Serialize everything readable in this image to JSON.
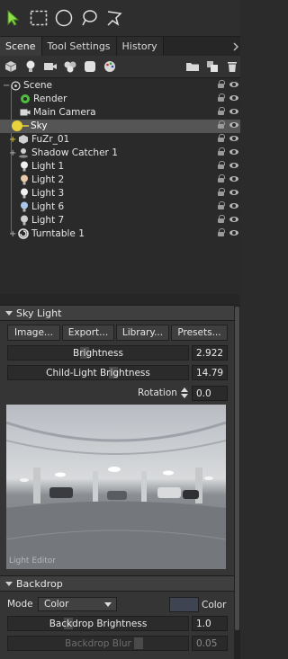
{
  "toolbar": {
    "tools": [
      "select-arrow-icon",
      "rect-select-icon",
      "circle-select-icon",
      "lasso-select-icon",
      "paint-select-icon"
    ]
  },
  "tabs": [
    {
      "label": "Scene",
      "active": true
    },
    {
      "label": "Tool Settings",
      "active": false
    },
    {
      "label": "History",
      "active": false
    }
  ],
  "scene_tree": {
    "root": "Scene",
    "items": [
      {
        "label": "Render",
        "icon": "render-icon"
      },
      {
        "label": "Main Camera",
        "icon": "camera-icon"
      },
      {
        "label": "Sky",
        "icon": "sky-icon",
        "selected": true
      },
      {
        "label": "FuZr_01",
        "icon": "model-icon",
        "expandable": true
      },
      {
        "label": "Shadow Catcher 1",
        "icon": "shadow-catcher-icon",
        "expandable": true
      },
      {
        "label": "Light 1",
        "icon": "light-bulb-icon"
      },
      {
        "label": "Light 2",
        "icon": "light-bulb-icon"
      },
      {
        "label": "Light 3",
        "icon": "light-bulb-icon"
      },
      {
        "label": "Light 6",
        "icon": "light-bulb-icon"
      },
      {
        "label": "Light 7",
        "icon": "light-bulb-icon"
      },
      {
        "label": "Turntable 1",
        "icon": "turntable-icon",
        "expandable": true
      }
    ]
  },
  "sky_light": {
    "title": "Sky Light",
    "buttons": [
      "Image...",
      "Export...",
      "Library...",
      "Presets..."
    ],
    "brightness_label": "Brightness",
    "brightness_value": "2.922",
    "child_brightness_label": "Child-Light Brightness",
    "child_brightness_value": "14.79",
    "rotation_label": "Rotation",
    "rotation_value": "0.0",
    "editor_watermark": "Light Editor"
  },
  "backdrop": {
    "title": "Backdrop",
    "mode_label": "Mode",
    "mode_value": "Color",
    "color_label": "Color",
    "brightness_label": "Backdrop Brightness",
    "brightness_value": "1.0",
    "blur_label": "Backdrop Blur",
    "blur_value": "0.05"
  },
  "colors": {
    "selection": "#555555",
    "accent_green": "#5cc85c",
    "accent_yellow": "#e8d33a"
  }
}
